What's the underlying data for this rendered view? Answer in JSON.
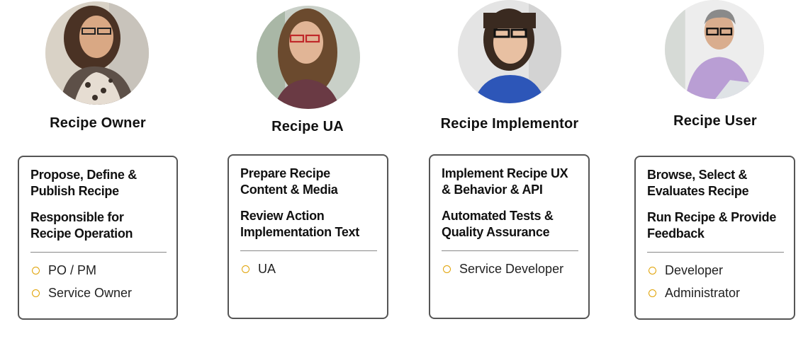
{
  "colors": {
    "bullet": "#e0a100",
    "border": "#555555",
    "text": "#111111"
  },
  "personas": [
    {
      "title": "Recipe Owner",
      "avatar_icon": "person-photo-icon",
      "responsibilities": [
        "Propose, Define & Publish Recipe",
        "Responsible for Recipe Operation"
      ],
      "members": [
        "PO / PM",
        "Service Owner"
      ]
    },
    {
      "title": "Recipe UA",
      "avatar_icon": "person-photo-icon",
      "responsibilities": [
        "Prepare Recipe Content & Media",
        "Review Action Implementation Text"
      ],
      "members": [
        "UA"
      ]
    },
    {
      "title": "Recipe Implementor",
      "avatar_icon": "person-photo-icon",
      "responsibilities": [
        "Implement Recipe UX & Behavior & API",
        "Automated Tests & Quality Assurance"
      ],
      "members": [
        "Service Developer"
      ]
    },
    {
      "title": "Recipe User",
      "avatar_icon": "person-photo-icon",
      "responsibilities": [
        "Browse, Select & Evaluates Recipe",
        "Run Recipe & Provide Feedback"
      ],
      "members": [
        "Developer",
        "Administrator"
      ]
    }
  ]
}
